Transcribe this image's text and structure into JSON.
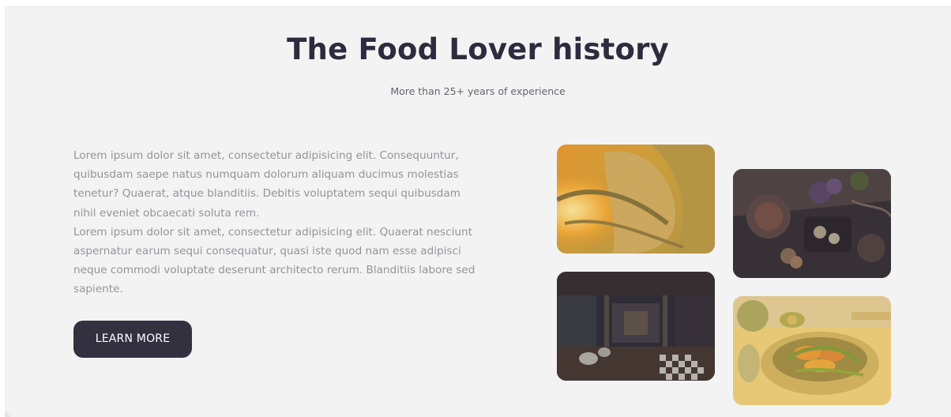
{
  "section": {
    "title": "The Food Lover history",
    "subtitle": "More than 25+ years of experience"
  },
  "content": {
    "paragraph_1": "Lorem ipsum dolor sit amet, consectetur adipisicing elit. Consequuntur, quibusdam saepe natus numquam dolorum aliquam ducimus molestias tenetur? Quaerat, atque blanditiis. Debitis voluptatem sequi quibusdam nihil eveniet obcaecati soluta rem.",
    "paragraph_2": "Lorem ipsum dolor sit amet, consectetur adipisicing elit. Quaerat nesciunt aspernatur earum sequi consequatur, quasi iste quod nam esse adipisci neque commodi voluptate deserunt architecto rerum. Blanditiis labore sed sapiente.",
    "button_label": "LEARN MORE"
  },
  "colors": {
    "background": "#f3f3f3",
    "heading": "#2d2b3d",
    "button": "#33313f",
    "body_text": "#94939b"
  }
}
